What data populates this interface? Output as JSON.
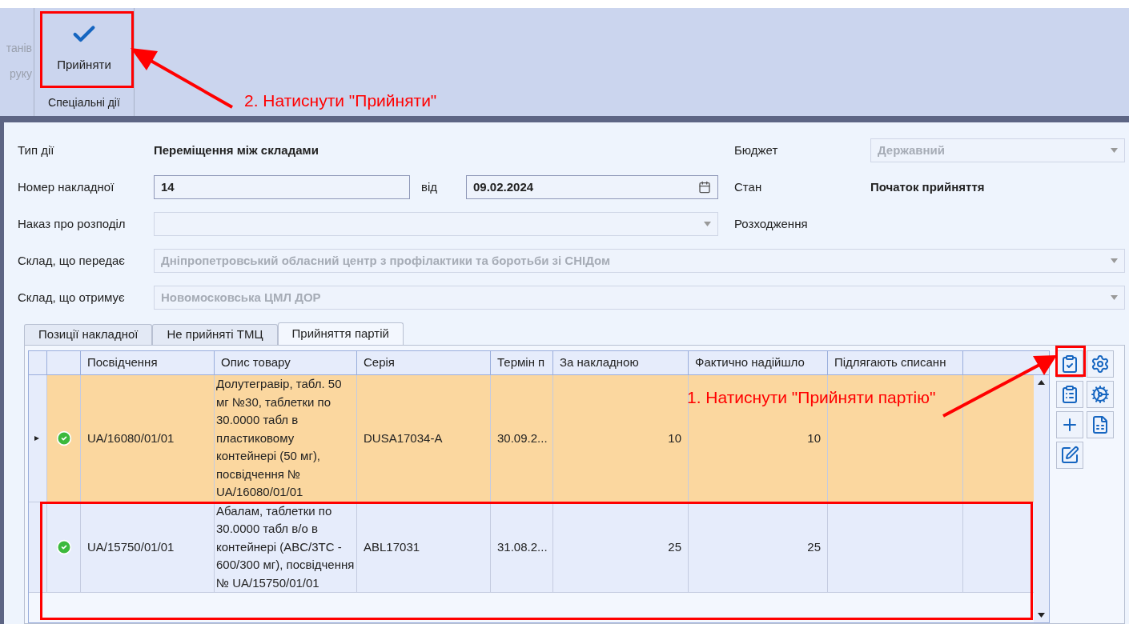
{
  "ribbon": {
    "cut_labels": [
      "танів",
      "руку"
    ],
    "group": {
      "label": "Спеціальні дії",
      "button": "Прийняти"
    }
  },
  "form": {
    "type_label": "Тип дії",
    "type_value": "Переміщення між складами",
    "budget_label": "Бюджет",
    "budget": {
      "value": "Державний",
      "disabled": true
    },
    "number_label": "Номер накладної",
    "number": "14",
    "date_label": "від",
    "date": "09.02.2024",
    "state_label": "Стан",
    "state_value": "Початок прийняття",
    "order_label": "Наказ про розподіл",
    "discrepancy_label": "Розходження",
    "sender_label": "Склад, що передає",
    "sender": {
      "value": "Дніпропетровський обласний центр з профілактики та боротьби зі СНІДом",
      "disabled": true
    },
    "receiver_label": "Склад, що отримує",
    "receiver": {
      "value": "Новомосковська ЦМЛ ДОР",
      "disabled": true
    }
  },
  "tabs": [
    {
      "label": "Позиції накладної",
      "selected": false
    },
    {
      "label": "Не прийняті ТМЦ",
      "selected": false
    },
    {
      "label": "Прийняття партій",
      "selected": true
    }
  ],
  "table": {
    "columns": [
      "Посвідчення",
      "Опис товару",
      "Серія",
      "Термін п",
      "За накладною",
      "Фактично надійшло",
      "Підлягають списанн"
    ],
    "rows": [
      {
        "selected": true,
        "cells": [
          "UA/16080/01/01",
          "Долутегравір, табл. 50 мг №30, таблетки  по 30.0000 табл в пластиковому контейнері (50 мг), посвідчення № UA/16080/01/01",
          "DUSA17034-A",
          "30.09.2...",
          "10",
          "10",
          ""
        ]
      },
      {
        "selected": false,
        "cells": [
          "UA/15750/01/01",
          "Абалам, таблетки  по 30.0000 табл в/о в контейнері (ABC/3TC - 600/300 мг), посвідчення № UA/15750/01/01",
          "ABL17031",
          "31.08.2...",
          "25",
          "25",
          ""
        ]
      }
    ]
  },
  "annotations": [
    "2. Натиснути \"Прийняти\"",
    "1. Натиснути \"Прийняти партію\""
  ]
}
